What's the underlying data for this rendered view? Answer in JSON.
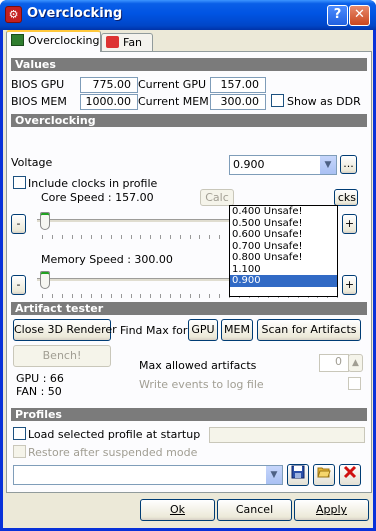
{
  "window": {
    "title": "Overclocking",
    "help_label": "?",
    "close_label": "✕"
  },
  "tabs": [
    {
      "label": "Overclocking"
    },
    {
      "label": "Fan"
    }
  ],
  "values": {
    "heading": "Values",
    "bios_gpu_label": "BIOS GPU",
    "bios_gpu": "775.00",
    "current_gpu_label": "Current GPU",
    "current_gpu": "157.00",
    "bios_mem_label": "BIOS MEM",
    "bios_mem": "1000.00",
    "current_mem_label": "Current MEM",
    "current_mem": "300.00",
    "show_ddr_label": "Show as DDR"
  },
  "overclocking": {
    "heading": "Overclocking",
    "voltage_label": "Voltage",
    "voltage_value": "0.900",
    "voltage_options": [
      "0.400 Unsafe!",
      "0.500 Unsafe!",
      "0.600 Unsafe!",
      "0.700 Unsafe!",
      "0.800 Unsafe!",
      "1.100",
      "0.900"
    ],
    "browse_label": "...",
    "include_clocks_label": "Include clocks in profile",
    "core_speed_label": "Core Speed : 157.00",
    "calc_button_partial": "Calc",
    "clocks_button_partial": "cks",
    "minus_label": "-",
    "plus_label": "+",
    "memory_speed_label": "Memory Speed : 300.00"
  },
  "artifact": {
    "heading": "Artifact tester",
    "close_3d_label": "Close 3D Renderer",
    "find_max_label": "Find Max for",
    "gpu_label": "GPU",
    "mem_label": "MEM",
    "scan_label": "Scan for Artifacts",
    "bench_label": "Bench!",
    "max_allowed_label": "Max allowed artifacts",
    "max_allowed_value": "0",
    "write_events_label": "Write events to log file",
    "gpu_status": "GPU : 66",
    "fan_status": "FAN : 50"
  },
  "profiles": {
    "heading": "Profiles",
    "load_label": "Load selected profile at startup",
    "restore_label": "Restore after suspended mode"
  },
  "footer": {
    "ok_label": "Ok",
    "cancel_label": "Cancel",
    "apply_label": "Apply"
  },
  "colors": {
    "title_blue": "#0054e3",
    "section_gray": "#7b7b7b",
    "dialog_bg": "#ece9d8",
    "selection": "#316ac5"
  }
}
